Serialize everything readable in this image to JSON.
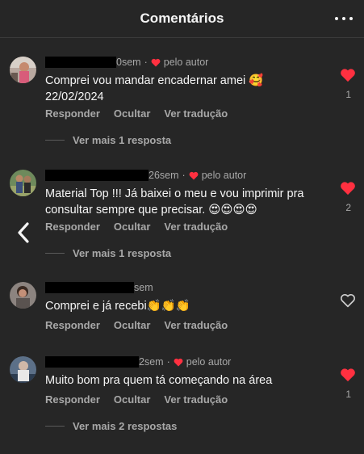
{
  "header": {
    "title": "Comentários"
  },
  "comments": [
    {
      "time": "0sem",
      "author_badge": "pelo autor",
      "text": "Comprei vou mandar encadernar amei 🥰 22/02/2024",
      "actions": [
        "Responder",
        "Ocultar",
        "Ver tradução"
      ],
      "replies_label": "Ver mais 1 resposta",
      "likes": "1",
      "liked": true
    },
    {
      "time": "26sem",
      "author_badge": "pelo autor",
      "text": "Material Top !!! Já baixei o meu e vou imprimir pra consultar sempre que precisar. 😍😍😍😍",
      "actions": [
        "Responder",
        "Ocultar",
        "Ver tradução"
      ],
      "replies_label": "Ver mais 1 resposta",
      "likes": "2",
      "liked": true
    },
    {
      "time": "sem",
      "author_badge": "",
      "text": "Comprei e já recebi👏👏👏",
      "actions": [
        "Responder",
        "Ocultar",
        "Ver tradução"
      ],
      "replies_label": "",
      "likes": "",
      "liked": false
    },
    {
      "time": "2sem",
      "author_badge": "pelo autor",
      "text": "Muito bom pra quem tá começando na área",
      "actions": [
        "Responder",
        "Ocultar",
        "Ver tradução"
      ],
      "replies_label": "Ver mais 2 respostas",
      "likes": "1",
      "liked": true
    }
  ],
  "colors": {
    "background": "#262626",
    "heart_red": "#ff3040",
    "secondary_text": "#a8a8a8"
  },
  "icons": {
    "more": "more-horizontal-icon",
    "back": "chevron-left-icon",
    "like": "heart-icon"
  }
}
